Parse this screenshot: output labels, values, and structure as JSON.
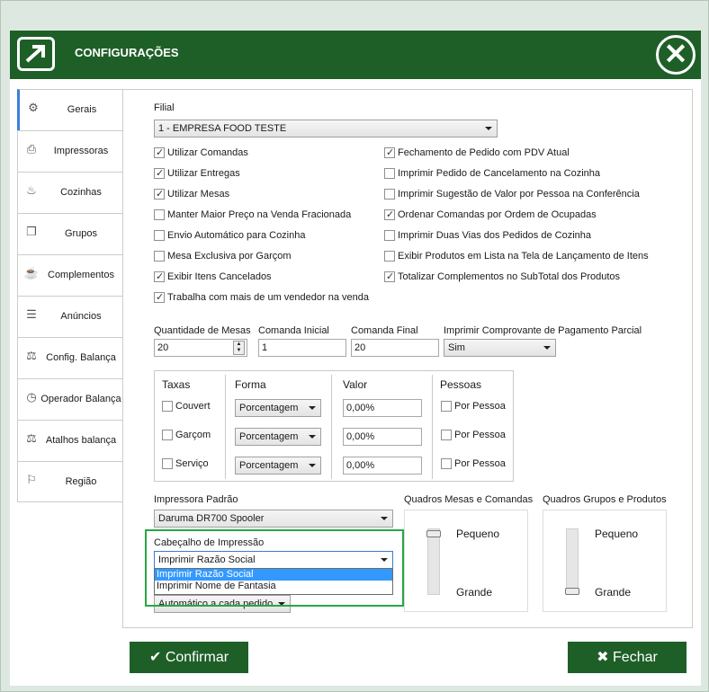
{
  "window": {
    "title": "CONFIGURAÇÕES"
  },
  "tabs": [
    {
      "label": "Gerais",
      "icon": "gear-icon"
    },
    {
      "label": "Impressoras",
      "icon": "printer-icon"
    },
    {
      "label": "Cozinhas",
      "icon": "kitchen-icon"
    },
    {
      "label": "Grupos",
      "icon": "groups-icon"
    },
    {
      "label": "Complementos",
      "icon": "complements-icon"
    },
    {
      "label": "Anúncios",
      "icon": "document-icon"
    },
    {
      "label": "Config. Balança",
      "icon": "scale-icon"
    },
    {
      "label": "Operador  Balança",
      "icon": "stopwatch-icon"
    },
    {
      "label": "Atalhos balança",
      "icon": "scale-shortcut-icon"
    },
    {
      "label": "Região",
      "icon": "flag-icon"
    }
  ],
  "filial": {
    "label": "Filial",
    "value": "1 - EMPRESA FOOD TESTE"
  },
  "checkboxes_left": [
    {
      "label": "Utilizar Comandas",
      "checked": true
    },
    {
      "label": "Utilizar Entregas",
      "checked": true
    },
    {
      "label": "Utilizar Mesas",
      "checked": true
    },
    {
      "label": "Manter Maior Preço na Venda Fracionada",
      "checked": false
    },
    {
      "label": "Envio Automático para Cozinha",
      "checked": false
    },
    {
      "label": "Mesa Exclusiva por Garçom",
      "checked": false
    },
    {
      "label": "Exibir Itens Cancelados",
      "checked": true
    },
    {
      "label": "Trabalha com mais de um vendedor na venda",
      "checked": true
    }
  ],
  "checkboxes_right": [
    {
      "label": "Fechamento de Pedido com PDV Atual",
      "checked": true
    },
    {
      "label": "Imprimir Pedido de Cancelamento na Cozinha",
      "checked": false
    },
    {
      "label": "Imprimir Sugestão de Valor por Pessoa na Conferência",
      "checked": false
    },
    {
      "label": "Ordenar Comandas por Ordem de Ocupadas",
      "checked": true
    },
    {
      "label": "Imprimir Duas Vias dos Pedidos de Cozinha",
      "checked": false
    },
    {
      "label": "Exibir Produtos em Lista na Tela de Lançamento de Itens",
      "checked": false
    },
    {
      "label": "Totalizar Complementos no SubTotal dos Produtos",
      "checked": true
    }
  ],
  "fields": {
    "quantidade_mesas": {
      "label": "Quantidade de Mesas",
      "value": "20"
    },
    "comanda_inicial": {
      "label": "Comanda Inicial",
      "value": "1"
    },
    "comanda_final": {
      "label": "Comanda Final",
      "value": "20"
    },
    "comprovante": {
      "label": "Imprimir Comprovante de Pagamento Parcial",
      "value": "Sim"
    }
  },
  "taxas": {
    "headers": {
      "taxas": "Taxas",
      "forma": "Forma",
      "valor": "Valor",
      "pessoas": "Pessoas"
    },
    "rows": [
      {
        "name": "Couvert",
        "forma": "Porcentagem",
        "valor": "0,00%",
        "pessoa": "Por Pessoa"
      },
      {
        "name": "Garçom",
        "forma": "Porcentagem",
        "valor": "0,00%",
        "pessoa": "Por Pessoa"
      },
      {
        "name": "Serviço",
        "forma": "Porcentagem",
        "valor": "0,00%",
        "pessoa": "Por Pessoa"
      }
    ]
  },
  "impressora": {
    "label": "Impressora Padrão",
    "value": "Daruma DR700 Spooler"
  },
  "cabecalho": {
    "label": "Cabeçalho de Impressão",
    "value": "Imprimir Razão Social",
    "options": [
      "Imprimir Razão Social",
      "Imprimir Nome de Fantasia"
    ],
    "below_value": "Automático a cada pedido"
  },
  "quadros_mesas": {
    "label": "Quadros Mesas e Comandas",
    "top": "Pequeno",
    "bottom": "Grande",
    "level": 0
  },
  "quadros_grupos": {
    "label": "Quadros Grupos e Produtos",
    "top": "Pequeno",
    "bottom": "Grande",
    "level": 1
  },
  "buttons": {
    "confirmar": "Confirmar",
    "fechar": "Fechar"
  },
  "colors": {
    "brand_green": "#1e5f28",
    "highlight": "#28a745",
    "selection": "#3399ff"
  }
}
